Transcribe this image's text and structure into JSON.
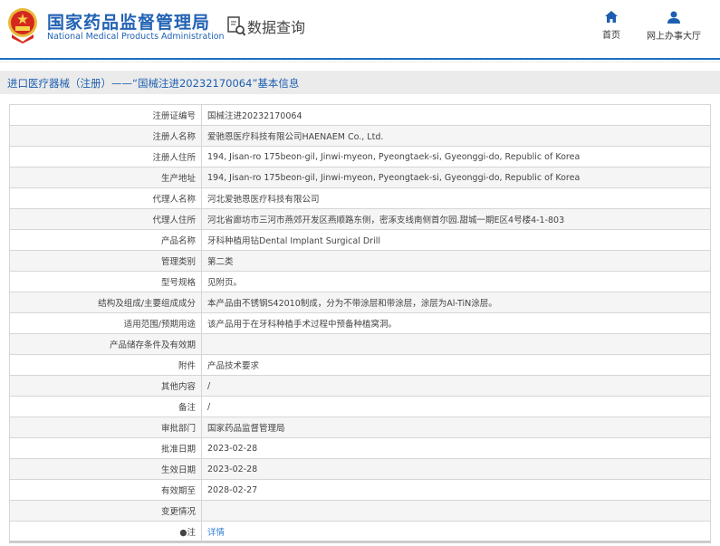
{
  "header": {
    "title_cn": "国家药品监督管理局",
    "title_en": "National Medical Products Administration",
    "section": "数据查询",
    "nav": [
      {
        "label": "首页",
        "icon": "home-icon"
      },
      {
        "label": "网上办事大厅",
        "icon": "user-icon"
      }
    ]
  },
  "breadcrumb": "进口医疗器械（注册）——“国械注进20232170064”基本信息",
  "rows": [
    {
      "label": "注册证编号",
      "value": "国械注进20232170064"
    },
    {
      "label": "注册人名称",
      "value": "爱驰恩医疗科技有限公司HAENAEM Co., Ltd."
    },
    {
      "label": "注册人住所",
      "value": "194, Jisan-ro 175beon-gil, Jinwi-myeon, Pyeongtaek-si, Gyeonggi-do, Republic of Korea"
    },
    {
      "label": "生产地址",
      "value": "194, Jisan-ro 175beon-gil, Jinwi-myeon, Pyeongtaek-si, Gyeonggi-do, Republic of Korea"
    },
    {
      "label": "代理人名称",
      "value": "河北爱驰恩医疗科技有限公司"
    },
    {
      "label": "代理人住所",
      "value": "河北省廊坊市三河市燕郊开发区燕顺路东侧，密涿支线南侧首尔园.甜城一期E区4号楼4-1-803"
    },
    {
      "label": "产品名称",
      "value": "牙科种植用钻Dental Implant Surgical Drill"
    },
    {
      "label": "管理类别",
      "value": "第二类"
    },
    {
      "label": "型号规格",
      "value": "见附页。"
    },
    {
      "label": "结构及组成/主要组成成分",
      "value": "本产品由不锈钢S42010制成，分为不带涂层和带涂层，涂层为Al-TiN涂层。"
    },
    {
      "label": "适用范围/预期用途",
      "value": "该产品用于在牙科种植手术过程中预备种植窝洞。"
    },
    {
      "label": "产品储存条件及有效期",
      "value": ""
    },
    {
      "label": "附件",
      "value": "产品技术要求"
    },
    {
      "label": "其他内容",
      "value": "/"
    },
    {
      "label": "备注",
      "value": "/"
    },
    {
      "label": "审批部门",
      "value": "国家药品监督管理局"
    },
    {
      "label": "批准日期",
      "value": "2023-02-28"
    },
    {
      "label": "生效日期",
      "value": "2023-02-28"
    },
    {
      "label": "有效期至",
      "value": "2028-02-27"
    },
    {
      "label": "变更情况",
      "value": ""
    },
    {
      "label": "●注",
      "value": "详情",
      "link": true
    }
  ]
}
